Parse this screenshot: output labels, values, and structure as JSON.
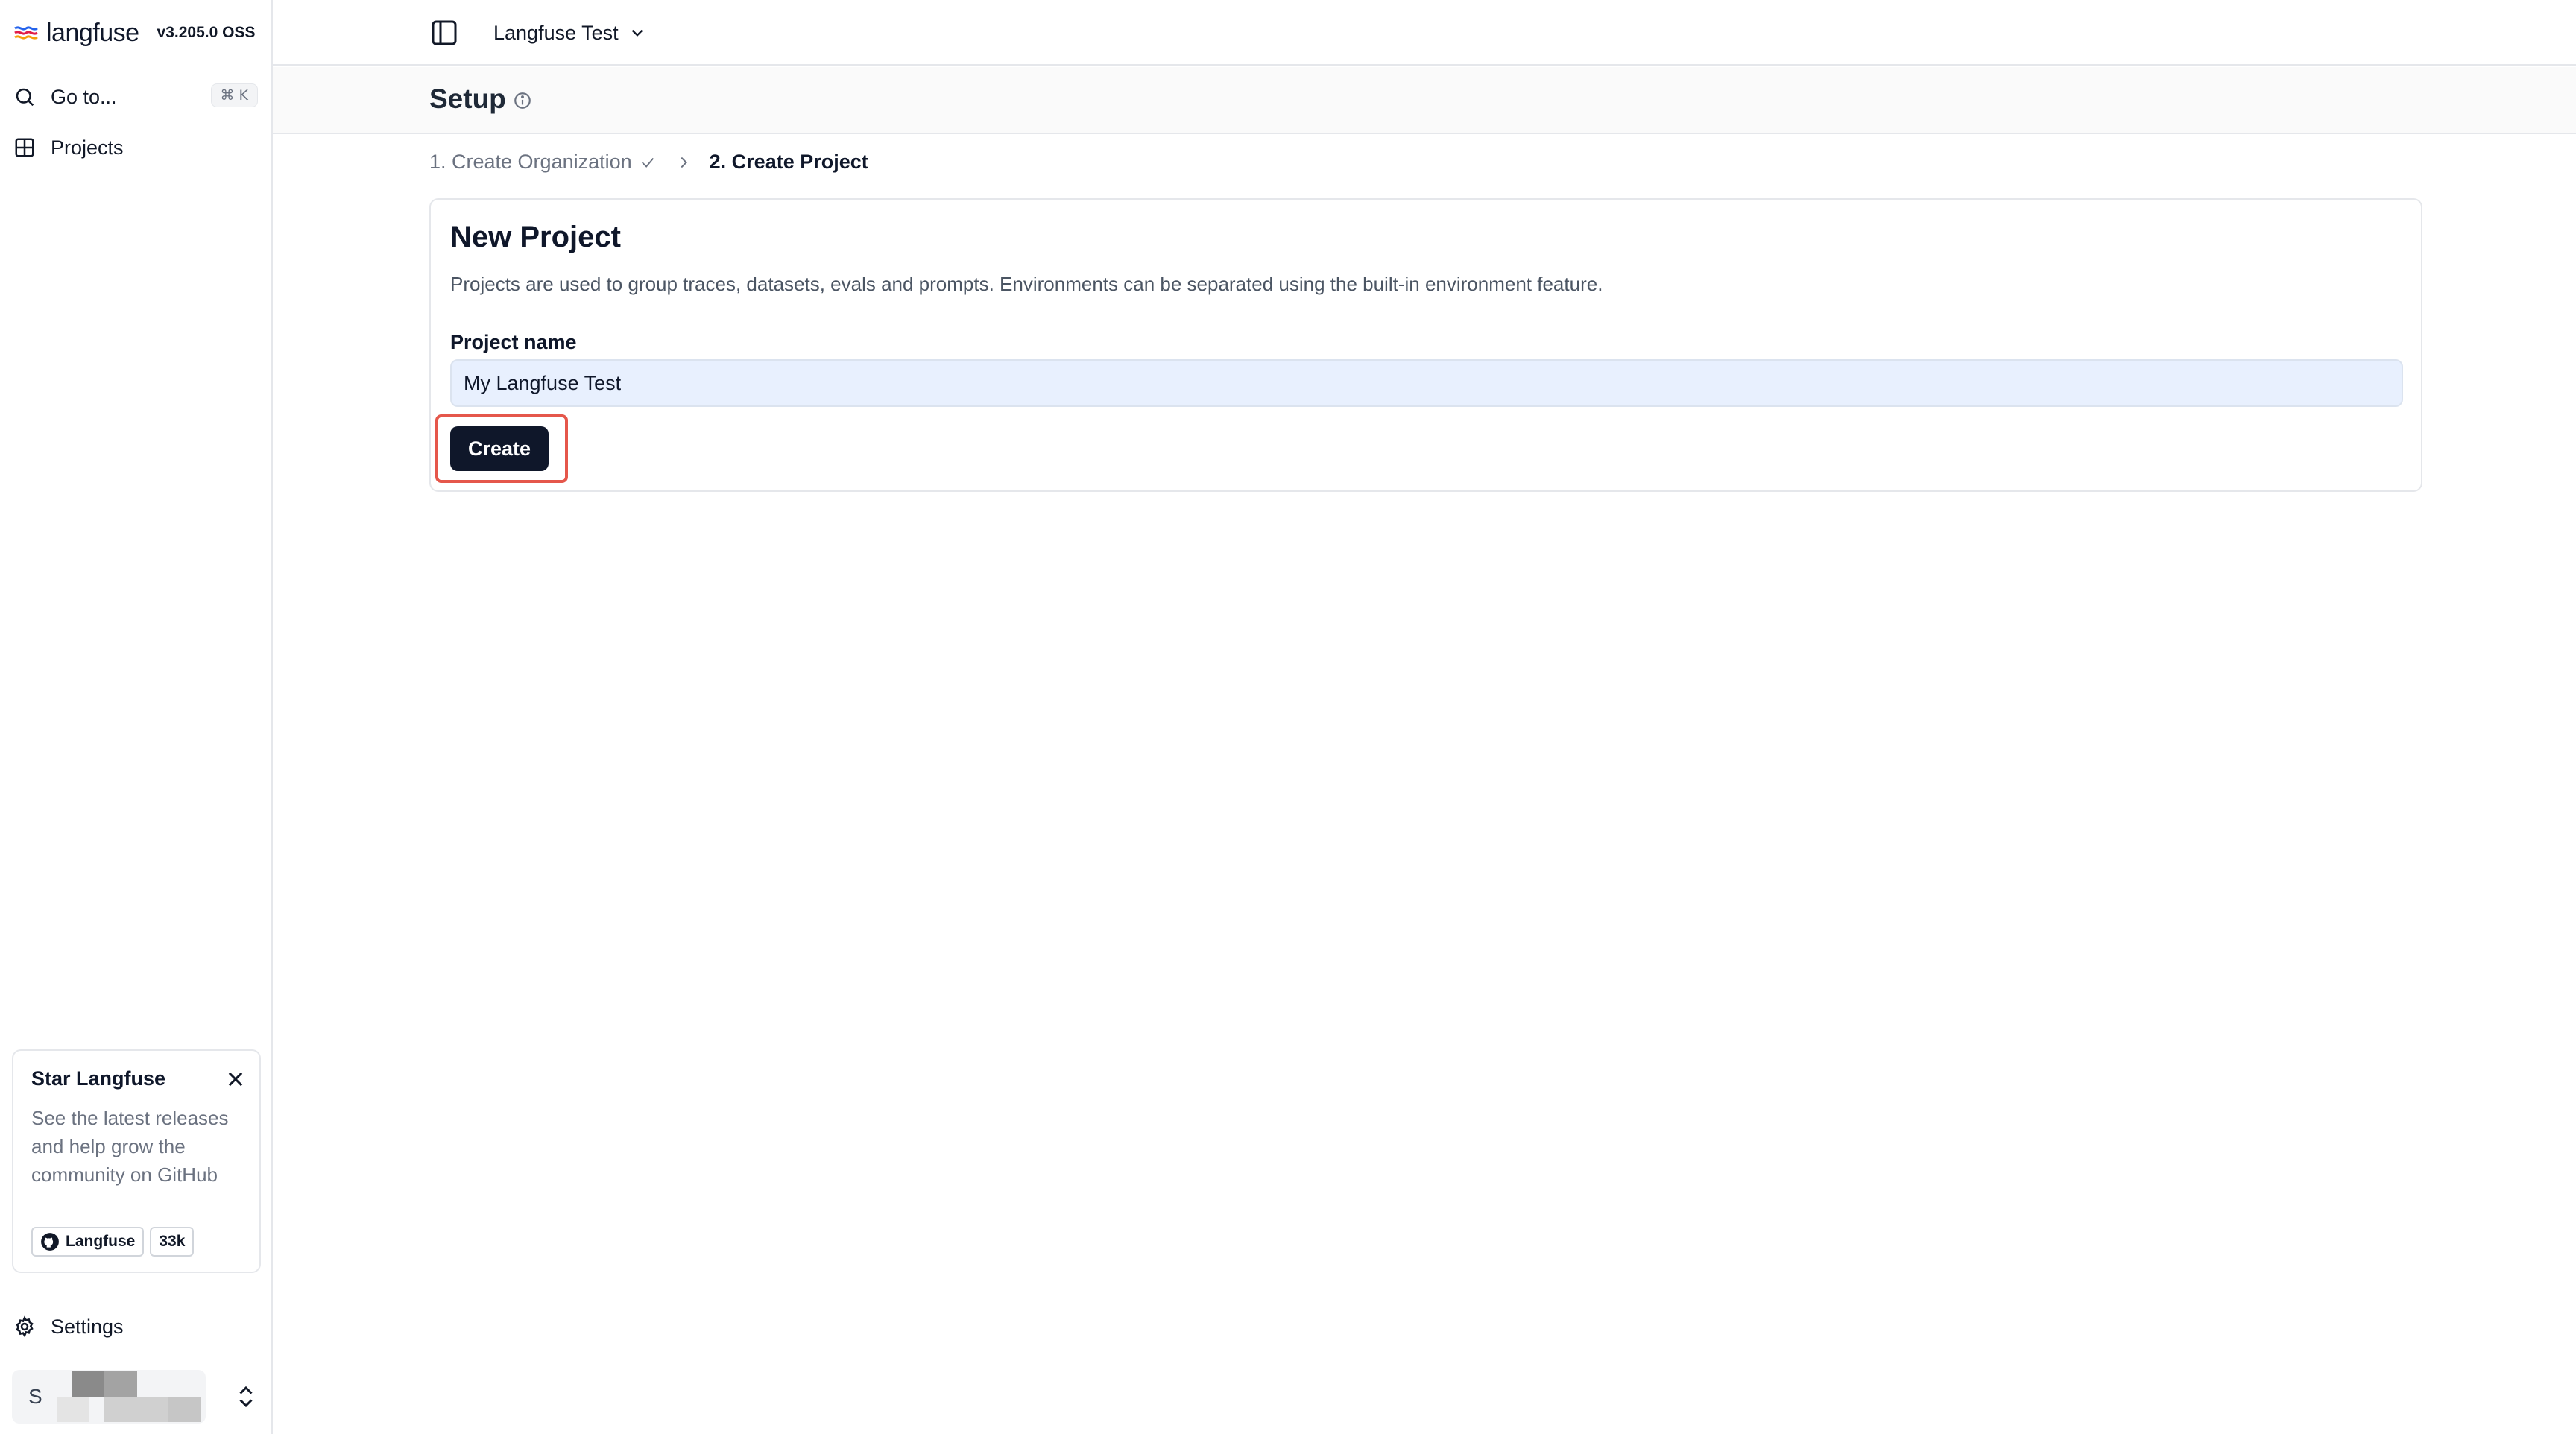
{
  "brand": {
    "name": "langfuse",
    "version": "v3.205.0 OSS"
  },
  "sidebar": {
    "goto_label": "Go to...",
    "goto_shortcut": "⌘ K",
    "projects_label": "Projects",
    "settings_label": "Settings",
    "user_initial": "S"
  },
  "star_card": {
    "title": "Star Langfuse",
    "text": "See the latest releases and help grow the community on GitHub",
    "github_label": "Langfuse",
    "star_count": "33k"
  },
  "topbar": {
    "project_name": "Langfuse Test"
  },
  "page": {
    "title": "Setup"
  },
  "steps": {
    "step1": "1. Create Organization",
    "step2": "2. Create Project"
  },
  "form": {
    "title": "New Project",
    "description": "Projects are used to group traces, datasets, evals and prompts. Environments can be separated using the built-in environment feature.",
    "field_label": "Project name",
    "field_value": "My Langfuse Test",
    "submit_label": "Create"
  },
  "colors": {
    "primary_button": "#0f172a",
    "highlight_outline": "#e5574b",
    "input_fill": "#e8f0fe"
  }
}
